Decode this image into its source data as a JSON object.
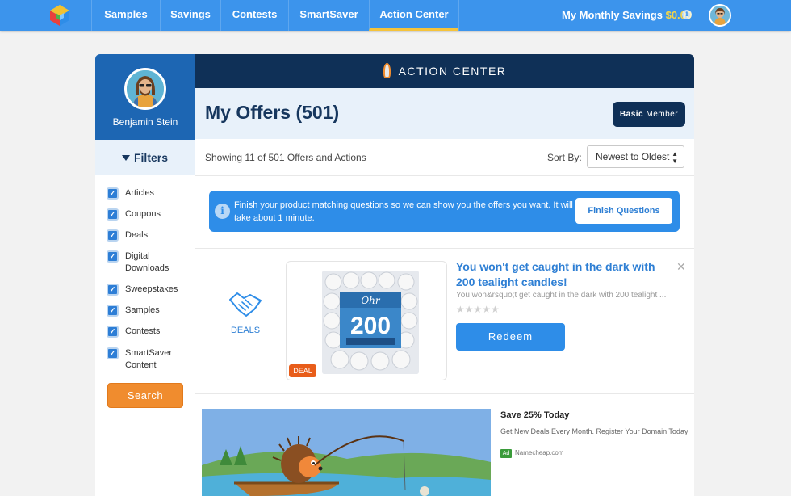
{
  "nav": {
    "items": [
      {
        "label": "Samples"
      },
      {
        "label": "Savings"
      },
      {
        "label": "Contests"
      },
      {
        "label": "SmartSaver"
      },
      {
        "label": "Action Center"
      }
    ],
    "savings_label": "My Monthly Savings",
    "savings_amount": "$0.00",
    "info_glyph": "i"
  },
  "profile": {
    "name": "Benjamin Stein"
  },
  "filters": {
    "heading": "Filters",
    "items": [
      {
        "label": "Articles",
        "checked": true
      },
      {
        "label": "Coupons",
        "checked": true
      },
      {
        "label": "Deals",
        "checked": true
      },
      {
        "label": "Digital Downloads",
        "checked": true
      },
      {
        "label": "Sweepstakes",
        "checked": true
      },
      {
        "label": "Samples",
        "checked": true
      },
      {
        "label": "Contests",
        "checked": true
      },
      {
        "label": "SmartSaver Content",
        "checked": true
      }
    ],
    "search_label": "Search"
  },
  "main": {
    "header": "ACTION CENTER",
    "title": "My Offers (501)",
    "member_level": "Basic",
    "member_label": "Member",
    "showing": "Showing 11 of 501 Offers and Actions",
    "sort_label": "Sort By:",
    "sort_value": "Newest to Oldest"
  },
  "notice": {
    "text": "Finish your product matching questions so we can show you the offers you want. It will take about 1 minute.",
    "button": "Finish Questions"
  },
  "offer": {
    "type_label": "DEALS",
    "badge": "DEAL",
    "title": "You won't get caught in the dark with 200 tealight candles!",
    "subtitle": "You won&rsquo;t get caught in the dark with 200 tealight ...",
    "stars": "★★★★★",
    "rating": 0,
    "redeem": "Redeem",
    "close": "✕",
    "product_count": "200"
  },
  "ad": {
    "title": "Save 25% Today",
    "description": "Get New Deals Every Month. Register Your Domain Today",
    "badge": "Ad",
    "domain": "Namecheap.com"
  },
  "colors": {
    "nav_bg": "#3c94ec",
    "active_underline": "#f5c33b",
    "savings_amount": "#f5d547",
    "header_navy": "#0f3057",
    "accent_blue": "#2e8de8",
    "search_orange": "#f08c2e",
    "deal_badge": "#e85d1a"
  },
  "icons": {
    "logo": "cube-logo-icon",
    "filter": "funnel-icon",
    "rocket": "rocket-icon",
    "deals": "handshake-icon",
    "info": "info-icon",
    "close": "close-icon"
  }
}
